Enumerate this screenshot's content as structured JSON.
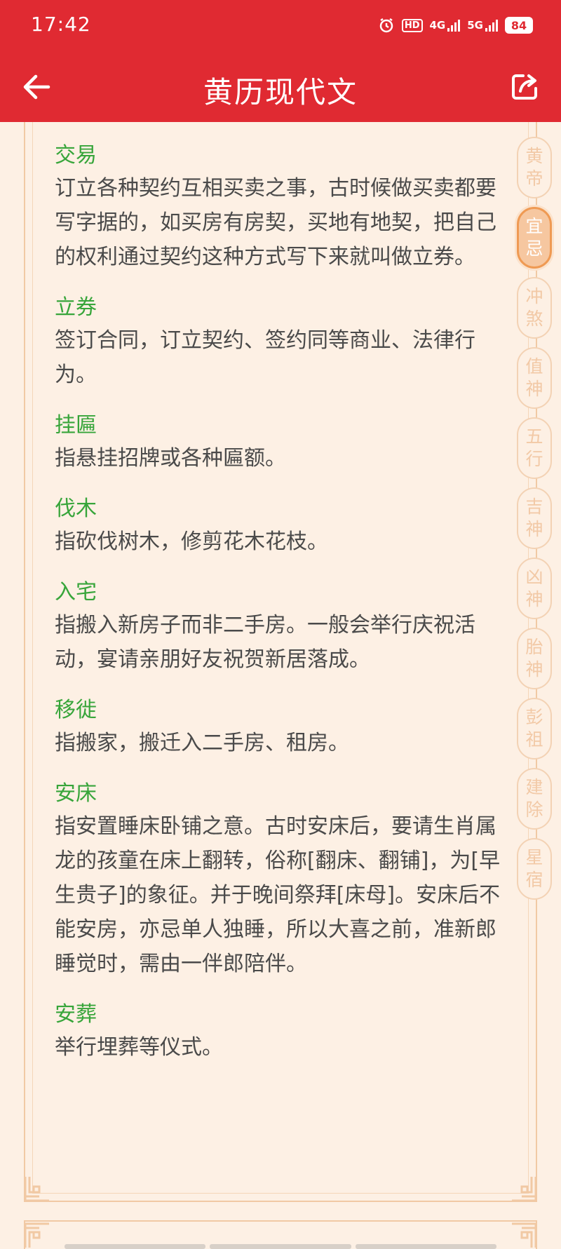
{
  "status_bar": {
    "time": "17:42",
    "icons": [
      "alarm-icon",
      "hd-icon",
      "4g-signal-icon",
      "5g-signal-icon"
    ],
    "hd_label": "HD",
    "network_4g": "4G",
    "network_5g": "5G",
    "battery": "84"
  },
  "header": {
    "title": "黄历现代文",
    "back_icon": "arrow-left-icon",
    "share_icon": "share-icon",
    "background": "#e02a32"
  },
  "terms": [
    {
      "title": "交易",
      "desc": "订立各种契约互相买卖之事，古时候做买卖都要写字据的，如买房有房契，买地有地契，把自己的权利通过契约这种方式写下来就叫做立券。"
    },
    {
      "title": "立券",
      "desc": "签订合同，订立契约、签约同等商业、法律行为。"
    },
    {
      "title": "挂匾",
      "desc": "指悬挂招牌或各种匾额。"
    },
    {
      "title": "伐木",
      "desc": "指砍伐树木，修剪花木花枝。"
    },
    {
      "title": "入宅",
      "desc": "指搬入新房子而非二手房。一般会举行庆祝活动，宴请亲朋好友祝贺新居落成。"
    },
    {
      "title": "移徙",
      "desc": "指搬家，搬迁入二手房、租房。"
    },
    {
      "title": "安床",
      "desc": "指安置睡床卧铺之意。古时安床后，要请生肖属龙的孩童在床上翻转，俗称[翻床、翻铺]，为[早生贵子]的象征。并于晚间祭拜[床母]。安床后不能安房，亦忌单人独睡，所以大喜之前，准新郎睡觉时，需由一伴郎陪伴。"
    },
    {
      "title": "安葬",
      "desc": "举行埋葬等仪式。"
    }
  ],
  "side_index": [
    {
      "top": "黄",
      "bottom": "帝",
      "active": false
    },
    {
      "top": "宜",
      "bottom": "忌",
      "active": true
    },
    {
      "top": "冲",
      "bottom": "煞",
      "active": false
    },
    {
      "top": "值",
      "bottom": "神",
      "active": false
    },
    {
      "top": "五",
      "bottom": "行",
      "active": false
    },
    {
      "top": "吉",
      "bottom": "神",
      "active": false
    },
    {
      "top": "凶",
      "bottom": "神",
      "active": false
    },
    {
      "top": "胎",
      "bottom": "神",
      "active": false
    },
    {
      "top": "彭",
      "bottom": "祖",
      "active": false
    },
    {
      "top": "建",
      "bottom": "除",
      "active": false
    },
    {
      "top": "星",
      "bottom": "宿",
      "active": false
    }
  ],
  "colors": {
    "term_title": "#37a53a",
    "term_text": "#4a4a4a",
    "accent_orange": "#ef9a53",
    "page_bg": "#fdf0e4"
  }
}
